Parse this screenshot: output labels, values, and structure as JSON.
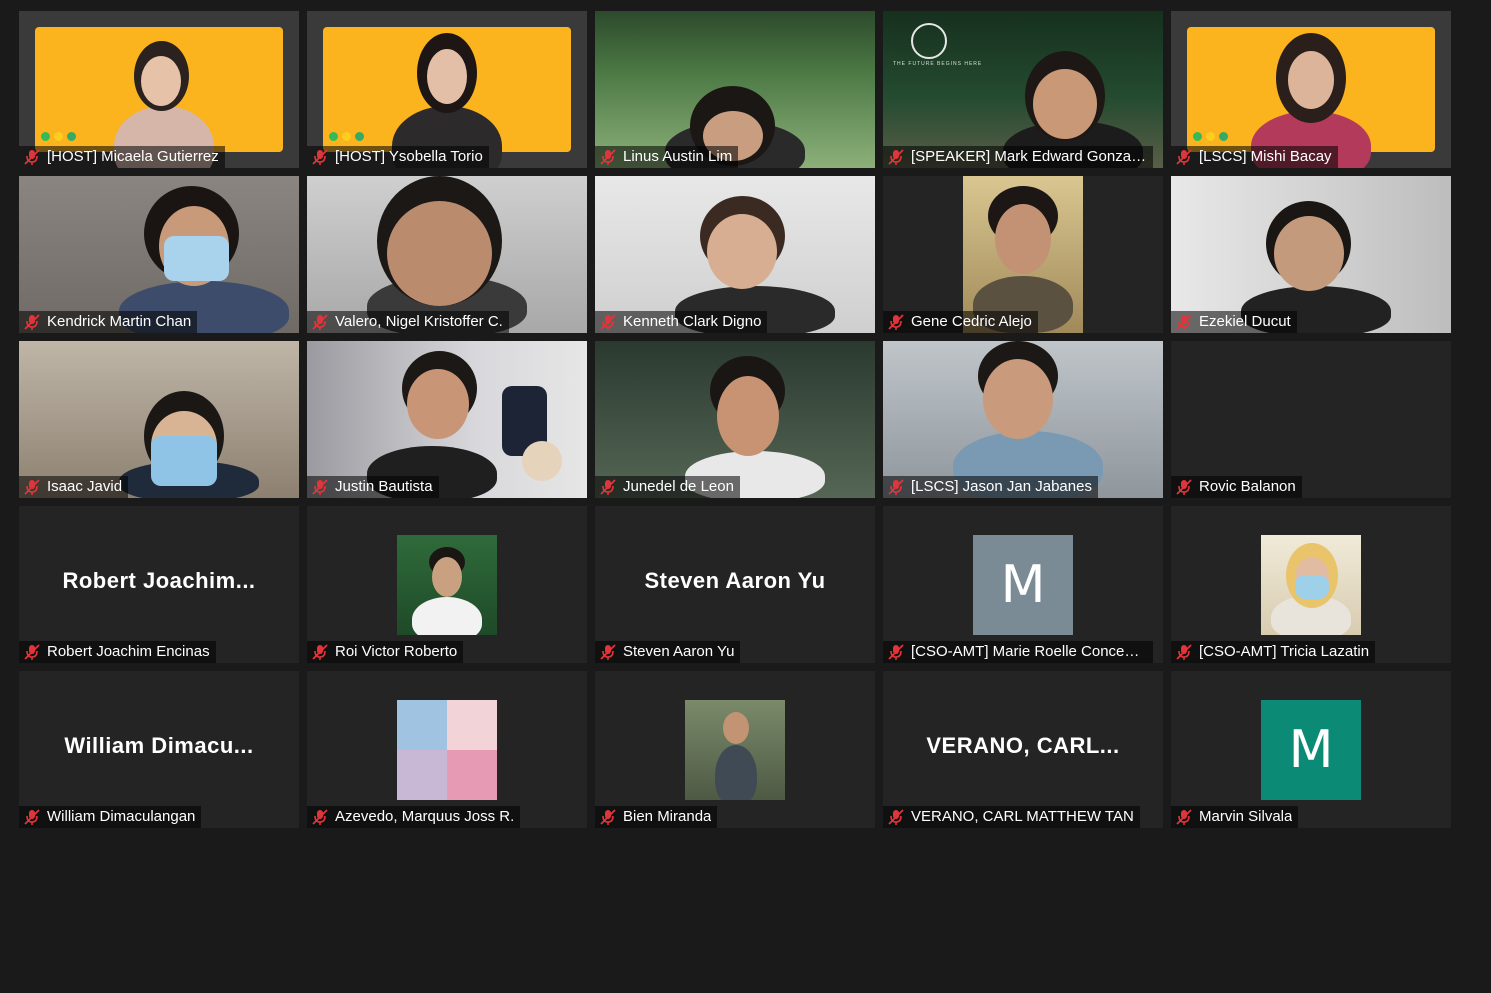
{
  "participants": [
    {
      "name": "[HOST] Micaela Gutierrez",
      "mic_muted": true,
      "view": "video"
    },
    {
      "name": "[HOST] Ysobella Torio",
      "mic_muted": true,
      "view": "video",
      "active_speaker": true
    },
    {
      "name": "Linus Austin Lim",
      "mic_muted": true,
      "view": "video"
    },
    {
      "name": "[SPEAKER] Mark Edward Gonzales",
      "mic_muted": true,
      "view": "video",
      "background_text": "THE FUTURE BEGINS HERE"
    },
    {
      "name": "[LSCS] Mishi Bacay",
      "mic_muted": true,
      "view": "video"
    },
    {
      "name": "Kendrick Martin Chan",
      "mic_muted": true,
      "view": "video"
    },
    {
      "name": "Valero, Nigel Kristoffer C.",
      "mic_muted": true,
      "view": "video"
    },
    {
      "name": "Kenneth Clark Digno",
      "mic_muted": true,
      "view": "video"
    },
    {
      "name": "Gene Cedric Alejo",
      "mic_muted": true,
      "view": "video"
    },
    {
      "name": "Ezekiel Ducut",
      "mic_muted": true,
      "view": "video"
    },
    {
      "name": "Isaac Javid",
      "mic_muted": true,
      "view": "video"
    },
    {
      "name": "Justin Bautista",
      "mic_muted": true,
      "view": "video"
    },
    {
      "name": "Junedel de Leon",
      "mic_muted": true,
      "view": "video"
    },
    {
      "name": "[LSCS] Jason Jan Jabanes",
      "mic_muted": true,
      "view": "video"
    },
    {
      "name": "Rovic Balanon",
      "mic_muted": true,
      "view": "blank"
    },
    {
      "name": "Robert Joachim Encinas",
      "mic_muted": true,
      "view": "name",
      "display_name": "Robert  Joachim..."
    },
    {
      "name": "Roi Victor Roberto",
      "mic_muted": true,
      "view": "photo"
    },
    {
      "name": "Steven Aaron Yu",
      "mic_muted": true,
      "view": "name",
      "display_name": "Steven Aaron Yu"
    },
    {
      "name": "[CSO-AMT] Marie Roelle Concepci...",
      "mic_muted": true,
      "view": "letter",
      "letter": "M",
      "avatar_color": "#7a8b96"
    },
    {
      "name": "[CSO-AMT] Tricia Lazatin",
      "mic_muted": true,
      "view": "photo"
    },
    {
      "name": "William Dimaculangan",
      "mic_muted": true,
      "view": "name",
      "display_name": "William  Dimacu..."
    },
    {
      "name": "Azevedo, Marquus Joss R.",
      "mic_muted": true,
      "view": "photo"
    },
    {
      "name": "Bien Miranda",
      "mic_muted": true,
      "view": "photo"
    },
    {
      "name": "VERANO, CARL MATTHEW  TAN",
      "mic_muted": true,
      "view": "name",
      "display_name": "VERANO,  CARL..."
    },
    {
      "name": "Marvin Silvala",
      "mic_muted": true,
      "view": "letter",
      "letter": "M",
      "avatar_color": "#0b8a75"
    }
  ],
  "icons": {
    "mic_muted": "mic-muted-icon"
  },
  "colors": {
    "active_border": "#d7e86a",
    "mic_muted": "#e0353a",
    "yellow_bg": "#fbb41d"
  }
}
